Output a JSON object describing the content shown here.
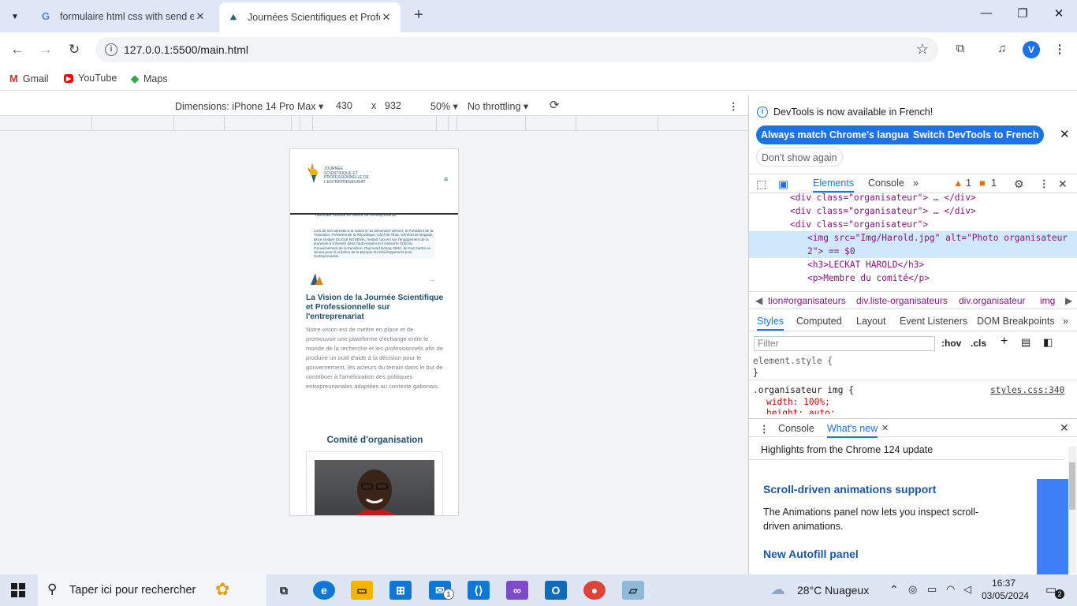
{
  "browser": {
    "tabs": [
      {
        "title": "formulaire html css with send e",
        "active": false
      },
      {
        "title": "Journées Scientifiques et Profes",
        "active": true
      }
    ],
    "url": "127.0.0.1:5500/main.html",
    "profile_initial": "V",
    "bookmarks": [
      "Gmail",
      "YouTube",
      "Maps"
    ]
  },
  "device_toolbar": {
    "dimensions_label": "Dimensions: iPhone 14 Pro Max",
    "width": "430",
    "times": "x",
    "height": "932",
    "zoom": "50%",
    "throttling": "No throttling"
  },
  "page": {
    "logo_text": "JOURNÉE SCIENTIFIQUE ET PROFESSIONNELLE DE L'ENTREPRENEURIAT",
    "menu_glyph": "≡",
    "clipped_text": "nationale robuste en faveur de l'entreprenariat",
    "quote_paragraph": "Lors de son adresse à la nation le 31 Décembre dernier, le Président de la Transition, Président de la République, Chef de l'État, Général de Brigade, Brice clotaire OLIGUI NGUEMA, mettait l'accent sur l'engagement de la jeunesse à s'investir dans l'auto-emploi et il instruit le Chef du Gouvernement de la transition, Raymond Ndong SIMA, de tout mettre en œuvre pour la création de la Banque du Développement pour l'entreprenariat.",
    "vision_title": "La Vision de la Journée Scientifique et Professionnelle sur l'entreprenariat",
    "vision_text": "Notre vision est de mettre en place et de promouvoir une plateforme d'échange entre le monde de la recherche et les professionnels afin de produire un outil d'aide à la décision pour le gouvernement, les acteurs du terrain dans le but de contribuer à l'amélioration des politiques entrepreunariales adaptées au contexte gabonais.",
    "committee_title": "Comité d'organisation"
  },
  "devtools": {
    "notice": "DevTools is now available in French!",
    "btn_match": "Always match Chrome's language",
    "btn_switch": "Switch DevTools to French",
    "btn_dont_show": "Don't show again",
    "tabs": [
      "Elements",
      "Console"
    ],
    "warn_count": "1",
    "issue_count": "1",
    "code_lines": [
      "<div class=\"organisateur\"> … </div>",
      "<div class=\"organisateur\"> … </div>",
      "<div class=\"organisateur\">",
      "<img src=\"Img/Harold.jpg\" alt=\"Photo organisateur",
      "2\"> == $0",
      "<h3>LECKAT HAROLD</h3>",
      "<p>Membre du comité</p>"
    ],
    "breadcrumbs": [
      "tion#organisateurs",
      "div.liste-organisateurs",
      "div.organisateur",
      "img"
    ],
    "style_tabs": [
      "Styles",
      "Computed",
      "Layout",
      "Event Listeners",
      "DOM Breakpoints"
    ],
    "filter_placeholder": "Filter",
    "hov": ":hov",
    "cls": ".cls",
    "style_rules": [
      "element.style {",
      "}",
      ".organisateur img {",
      "width: 100%;",
      "height: auto;"
    ],
    "style_source": "styles.css:340",
    "drawer_tabs": [
      "Console",
      "What's new"
    ],
    "highlights": "Highlights from the Chrome 124 update",
    "feature1_title": "Scroll-driven animations support",
    "feature1_text": "The Animations panel now lets you inspect scroll-driven animations.",
    "feature2_title": "New Autofill panel"
  },
  "taskbar": {
    "search_placeholder": "Taper ici pour rechercher",
    "weather": "28°C  Nuageux",
    "time": "16:37",
    "date": "03/05/2024",
    "notification_count": "2",
    "mail_badge": "1"
  }
}
